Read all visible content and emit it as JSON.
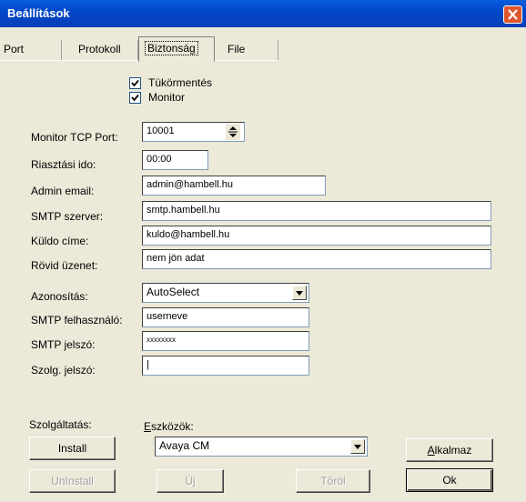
{
  "window": {
    "title": "Beállítások"
  },
  "tabs": [
    {
      "label": "Port"
    },
    {
      "label": "Protokoll"
    },
    {
      "label": "Biztonság",
      "active": true
    },
    {
      "label": "File"
    }
  ],
  "checkboxes": [
    {
      "label": "Tükörmentés",
      "checked": true
    },
    {
      "label": "Monitor",
      "checked": true
    }
  ],
  "fields": {
    "monitor_tcp_port": {
      "label": "Monitor TCP Port:",
      "value": "10001"
    },
    "riasztasi_ido": {
      "label": "Riasztási ido:",
      "value": "00:00"
    },
    "admin_email": {
      "label": "Admin email:",
      "value": "admin@hambell.hu"
    },
    "smtp_szerver": {
      "label": "SMTP szerver:",
      "value": "smtp.hambell.hu"
    },
    "kuldo_cime": {
      "label": "Küldo címe:",
      "value": "kuldo@hambell.hu"
    },
    "rovid_uzenet": {
      "label": "Rövid üzenet:",
      "value": "nem jön adat"
    },
    "azonositas": {
      "label": "Azonosítás:",
      "value": "AutoSelect"
    },
    "smtp_felhasznalo": {
      "label": "SMTP felhasználó:",
      "value": "userneve"
    },
    "smtp_jelszo": {
      "label": "SMTP jelszó:",
      "value": "xxxxxxxx"
    },
    "szolg_jelszo": {
      "label": "Szolg. jelszó:",
      "value": "|"
    }
  },
  "service": {
    "label": "Szolgáltatás:",
    "install": "Install",
    "uninstall": "UnInstall"
  },
  "tools": {
    "label": "Eszközök:",
    "value": "Avaya CM",
    "new": "Új",
    "delete": "Töröl"
  },
  "actions": {
    "apply": "Alkalmaz",
    "ok": "Ok"
  },
  "colors": {
    "titlebar": "#0a4fd6",
    "face": "#ece9d8",
    "close": "#e0552c"
  }
}
